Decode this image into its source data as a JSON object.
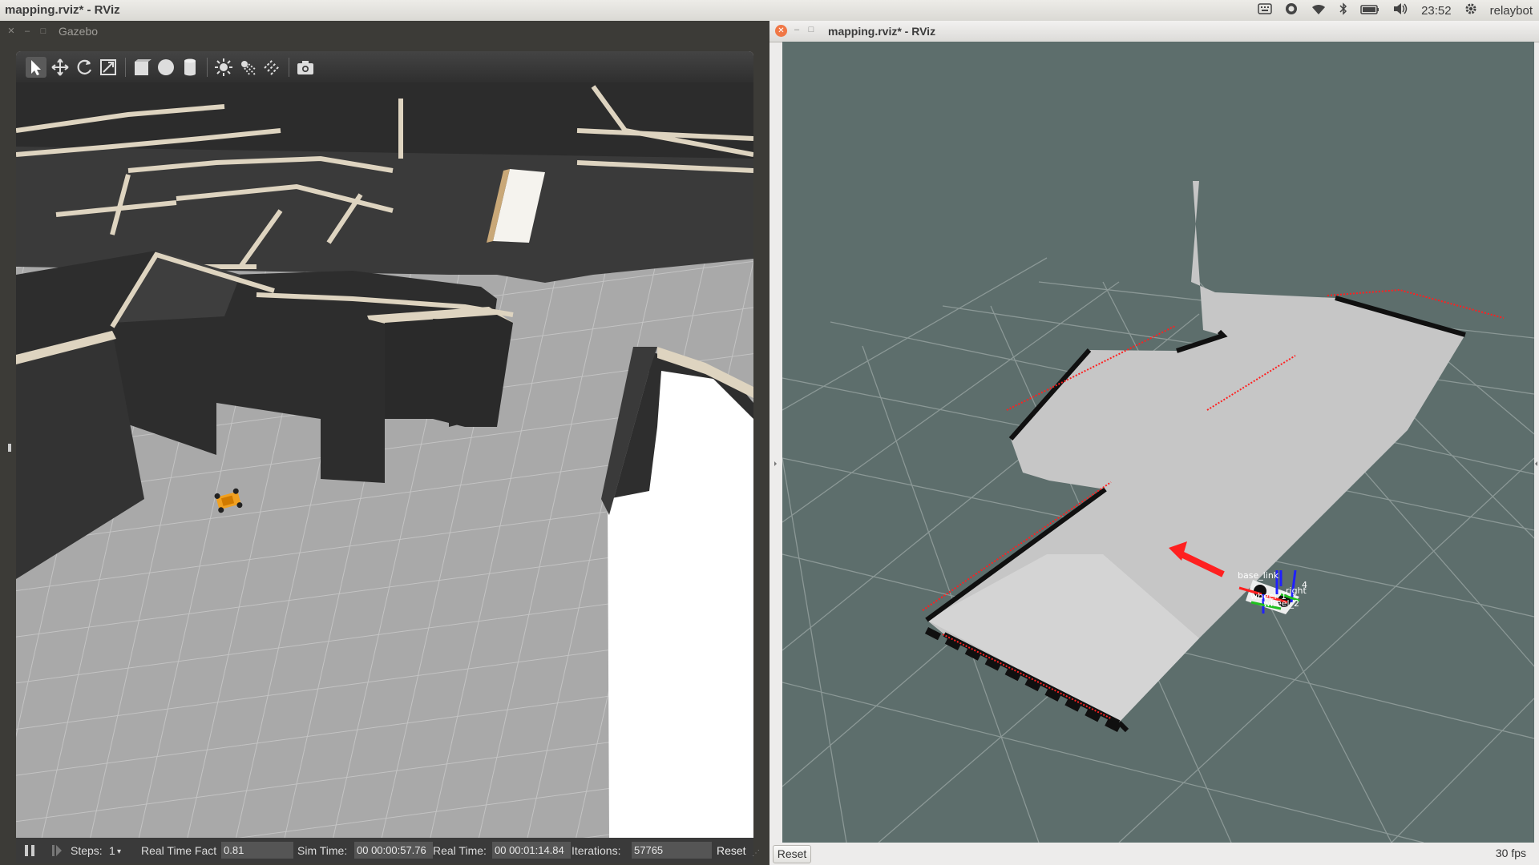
{
  "topbar": {
    "title": "mapping.rviz* - RViz",
    "time": "23:52",
    "user": "relaybot"
  },
  "gazebo": {
    "window_title": "Gazebo",
    "toolbar_icons": [
      "select-arrow-icon",
      "translate-icon",
      "rotate-icon",
      "scale-icon",
      "box-shape-icon",
      "sphere-shape-icon",
      "cylinder-shape-icon",
      "point-light-icon",
      "spot-light-icon",
      "directional-light-icon",
      "screenshot-icon"
    ],
    "status": {
      "steps_label": "Steps:",
      "steps_value": "1",
      "rtf_label": "Real Time Fact",
      "rtf_value": "0.81",
      "sim_time_label": "Sim Time:",
      "sim_time_value": "00 00:00:57.76",
      "real_time_label": "Real Time:",
      "real_time_value": "00 00:01:14.84",
      "iterations_label": "Iterations:",
      "iterations_value": "57765",
      "reset_label": "Reset"
    }
  },
  "rviz": {
    "window_title": "mapping.rviz* - RViz",
    "robot_labels": {
      "a": "base_link",
      "b": "wheel_1",
      "c": "wheel_2",
      "d": "right",
      "e": "4"
    },
    "reset_label": "Reset",
    "fps": "30 fps"
  },
  "colors": {
    "rviz_background": "#5d6e6c",
    "map_free": "#c8c8c8",
    "laser_scan": "#ff2020",
    "robot_orange": "#f0a020"
  }
}
